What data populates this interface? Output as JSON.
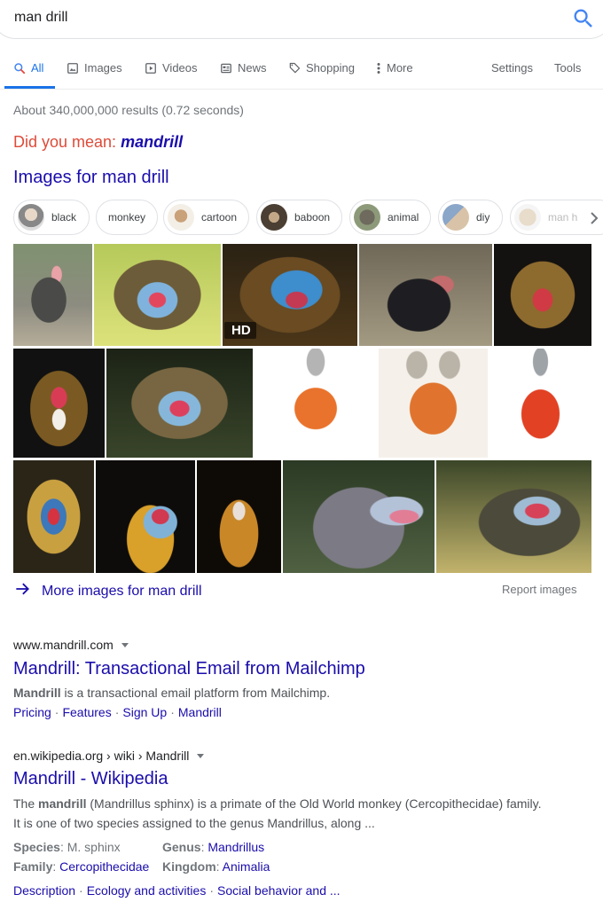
{
  "search": {
    "query": "man drill"
  },
  "tabs": [
    {
      "label": "All",
      "icon": "search-icon",
      "active": true
    },
    {
      "label": "Images",
      "icon": "image-icon"
    },
    {
      "label": "Videos",
      "icon": "video-icon"
    },
    {
      "label": "News",
      "icon": "news-icon"
    },
    {
      "label": "Shopping",
      "icon": "tag-icon"
    },
    {
      "label": "More",
      "icon": "more-vert-icon"
    },
    {
      "label": "Settings"
    },
    {
      "label": "Tools"
    }
  ],
  "result_stats": "About 340,000,000 results (0.72 seconds)",
  "did_you_mean": {
    "prefix": "Did you mean: ",
    "suggestion": "mandrill"
  },
  "images_section": {
    "heading": "Images for man drill",
    "chips": [
      "black",
      "monkey",
      "cartoon",
      "baboon",
      "animal",
      "diy",
      "man h"
    ],
    "hd_badge": "HD",
    "more_label": "More images for man drill",
    "report_label": "Report images"
  },
  "results": [
    {
      "cite": "www.mandrill.com",
      "title": "Mandrill: Transactional Email from Mailchimp",
      "snippet_bold": "Mandrill",
      "snippet_rest": " is a transactional email platform from Mailchimp.",
      "sitelinks": [
        "Pricing",
        "Features",
        "Sign Up",
        "Mandrill"
      ]
    },
    {
      "cite": "en.wikipedia.org › wiki › Mandrill",
      "title": "Mandrill - Wikipedia",
      "snippet_pre": "The ",
      "snippet_bold": "mandrill",
      "snippet_line1_rest": " (Mandrillus sphinx) is a primate of the Old World monkey (Cercopithecidae) family.",
      "snippet_line2": "It is one of two species assigned to the genus Mandrillus, along ...",
      "facts": {
        "species_key": "Species",
        "species_val": "M. sphinx",
        "genus_key": "Genus",
        "genus_val": "Mandrillus",
        "family_key": "Family",
        "family_val": "Cercopithecidae",
        "kingdom_key": "Kingdom",
        "kingdom_val": "Animalia"
      },
      "sitelinks": [
        "Description",
        "Ecology and activities",
        "Social behavior and ..."
      ]
    }
  ],
  "colors": {
    "accent": "#1a73e8",
    "link": "#1a0dab",
    "did_you_mean": "#dd4b39",
    "muted": "#70757a"
  }
}
